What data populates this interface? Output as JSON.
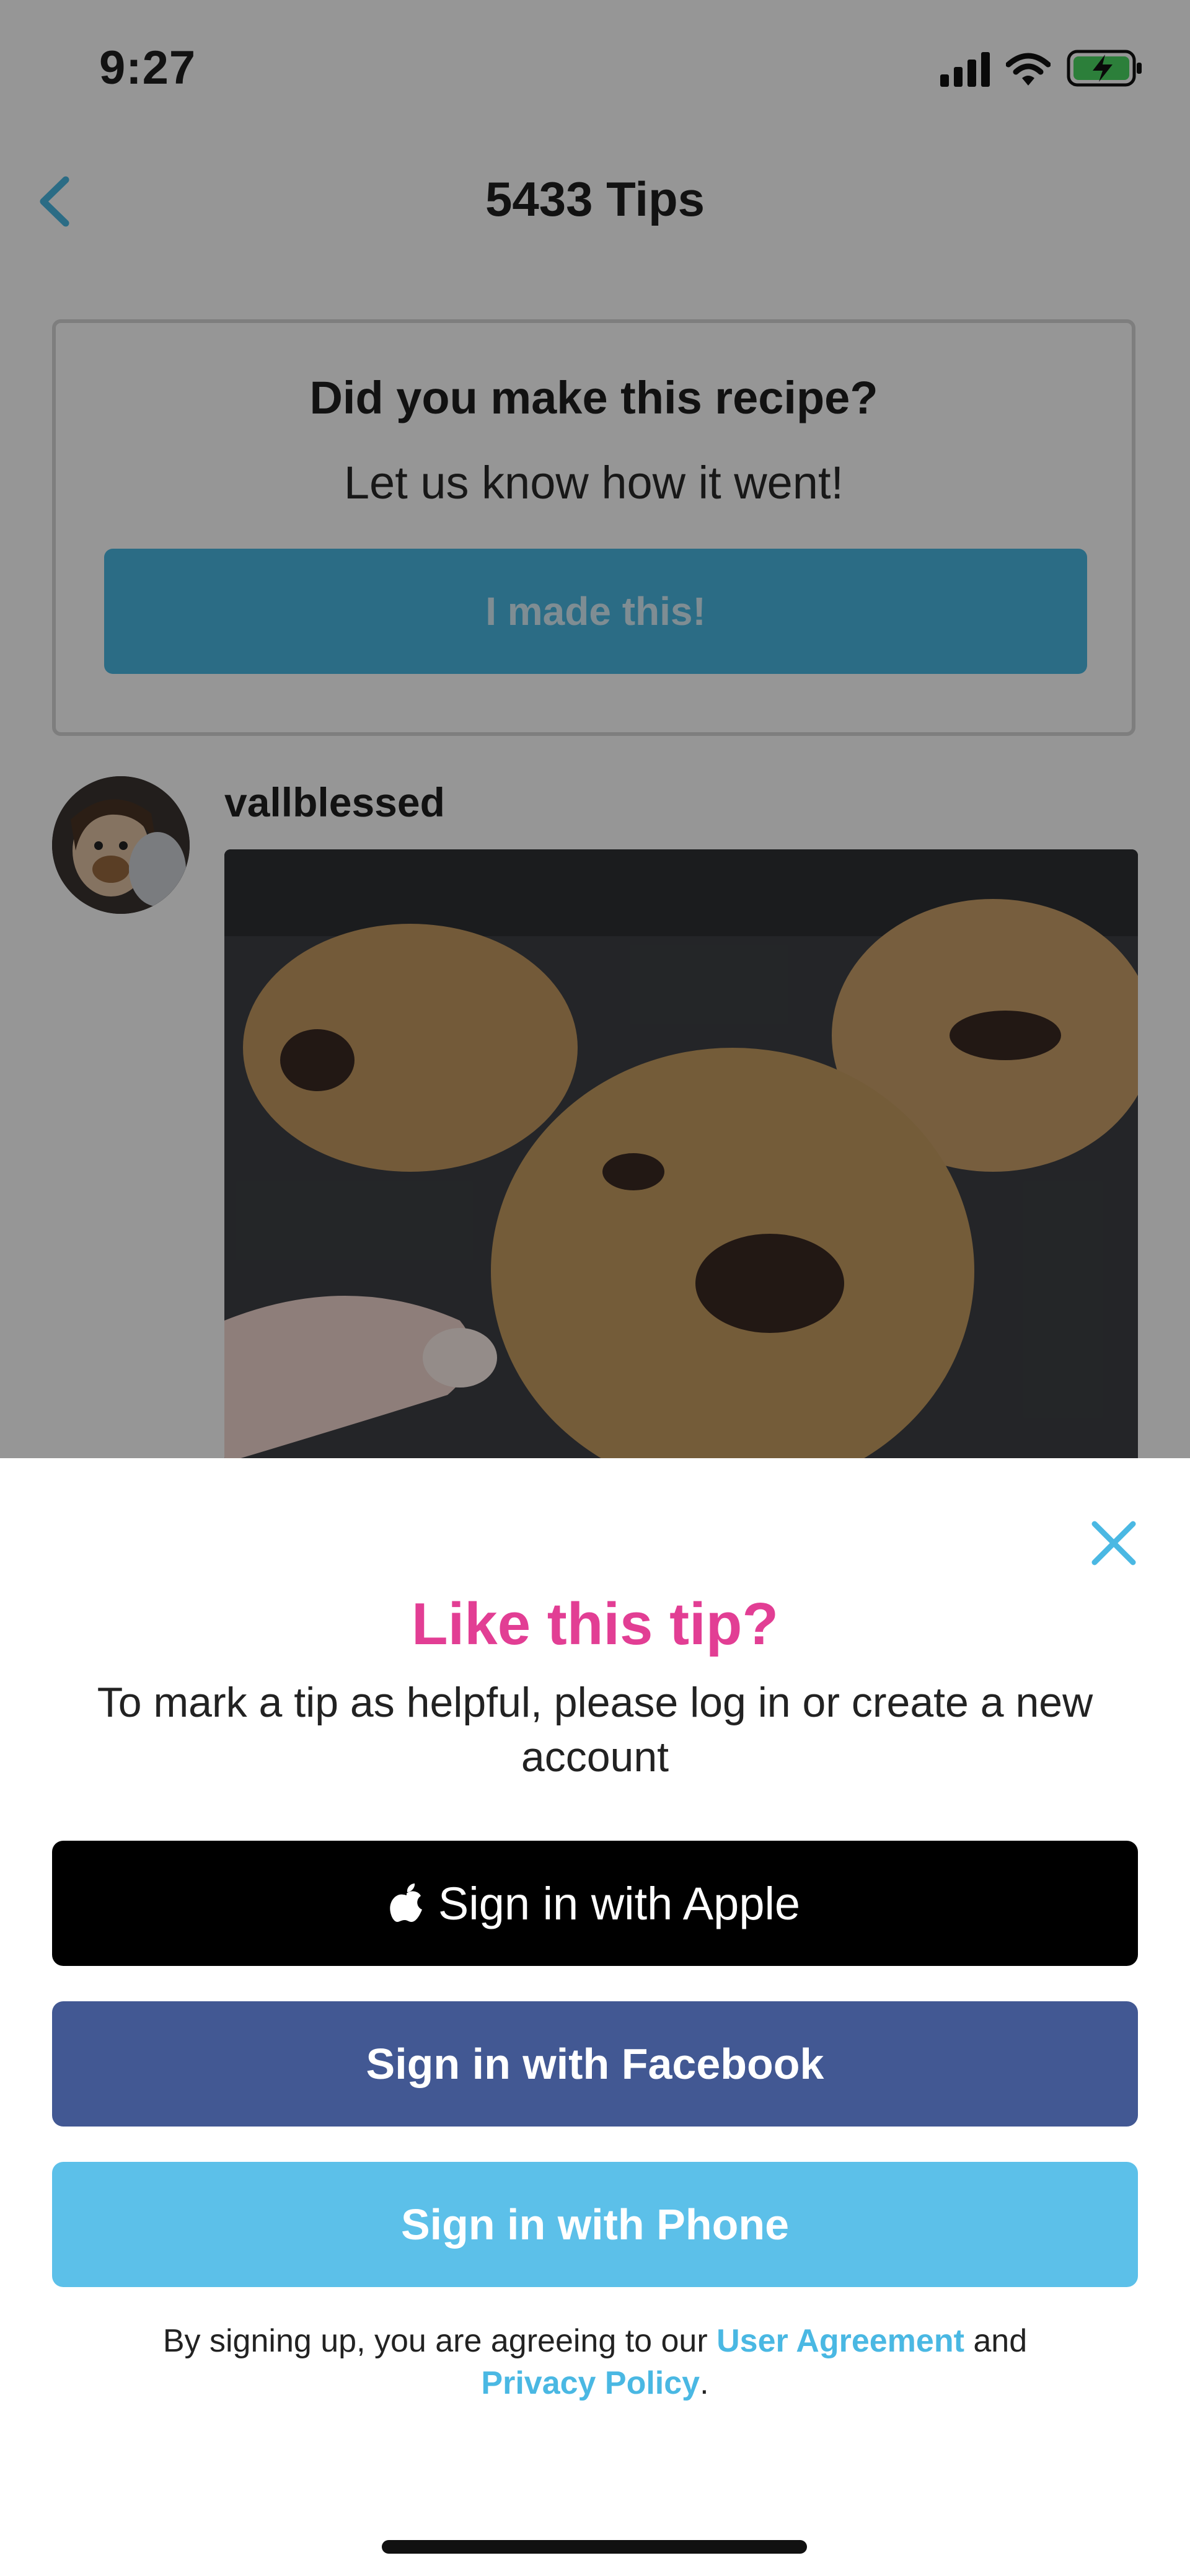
{
  "status_bar": {
    "time": "9:27",
    "icons": [
      "signal-icon",
      "wifi-icon",
      "battery-charging-icon"
    ]
  },
  "nav": {
    "title": "5433 Tips",
    "back_icon": "chevron-left-icon"
  },
  "recipe_prompt": {
    "title": "Did you make this recipe?",
    "subtitle": "Let us know how it went!",
    "button_label": "I made this!"
  },
  "tip": {
    "username": "vallblessed",
    "photo": "chocolate-chip-cookies-photo"
  },
  "modal": {
    "close_icon": "close-icon",
    "title": "Like this tip?",
    "message": "To mark a tip as helpful, please log in or create a new account",
    "apple_label": "Sign in with Apple",
    "facebook_label": "Sign in with Facebook",
    "phone_label": "Sign in with Phone",
    "legal_prefix": "By signing up, you are agreeing to our",
    "user_agreement": "User Agreement",
    "legal_and": "and",
    "privacy_policy": "Privacy Policy",
    "legal_suffix": "."
  },
  "colors": {
    "accent_blue": "#4ab8e3",
    "title_pink": "#e23e94",
    "facebook_blue": "#425893",
    "phone_blue": "#5cc0e9",
    "apple_black": "#000000"
  }
}
